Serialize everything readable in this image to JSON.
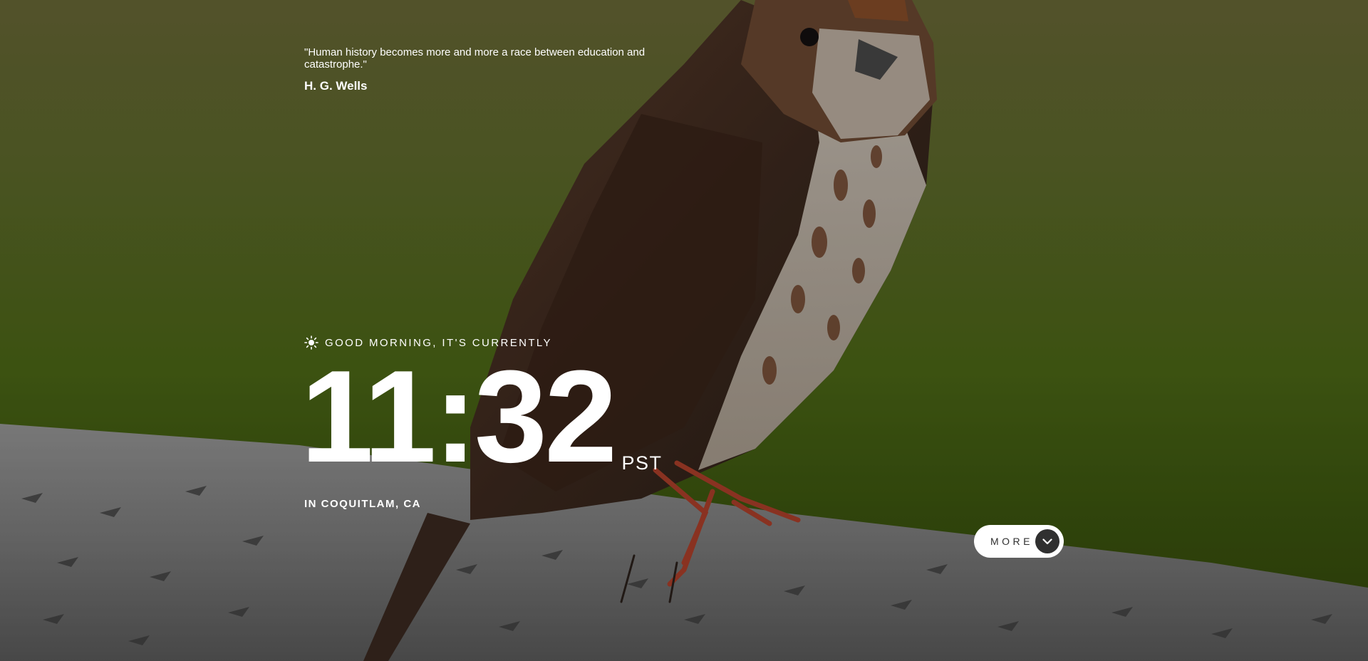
{
  "quote": {
    "text": "\"Human history becomes more and more a race between education and catastrophe.\"",
    "author": "H. G. Wells"
  },
  "greeting": {
    "icon": "sun-icon",
    "text": "GOOD MORNING, IT'S CURRENTLY"
  },
  "clock": {
    "time": "11:32",
    "timezone": "PST"
  },
  "location": {
    "text": "IN COQUITLAM, CA"
  },
  "more_button": {
    "label": "MORE",
    "icon": "chevron-down-icon"
  },
  "colors": {
    "background_green": "#4e6a17",
    "text": "#ffffff",
    "button_bg": "#ffffff",
    "button_text": "#303030"
  }
}
